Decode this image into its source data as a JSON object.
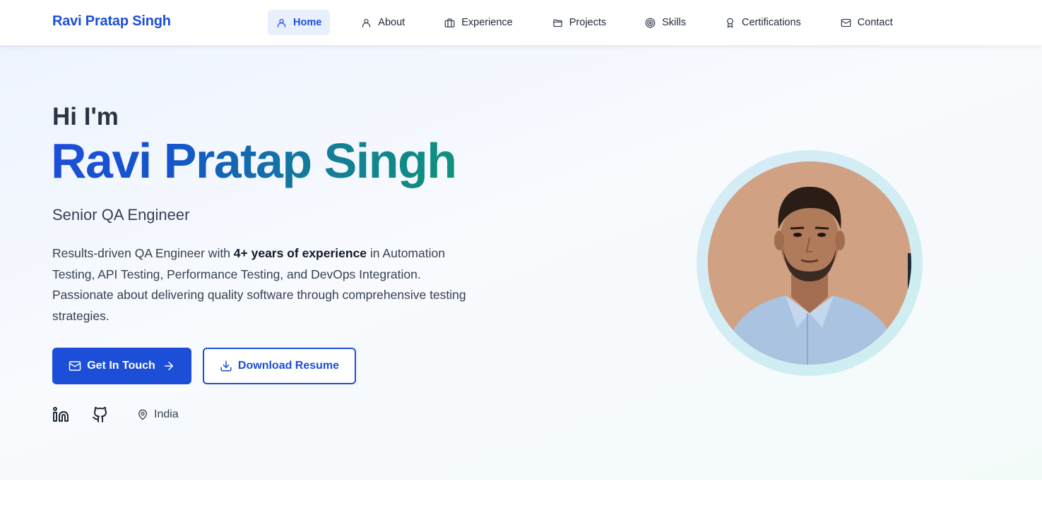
{
  "brand": "Ravi Pratap Singh",
  "nav": {
    "items": [
      {
        "label": "Home",
        "icon": "user-icon",
        "active": true
      },
      {
        "label": "About",
        "icon": "user-icon",
        "active": false
      },
      {
        "label": "Experience",
        "icon": "briefcase-icon",
        "active": false
      },
      {
        "label": "Projects",
        "icon": "folder-icon",
        "active": false
      },
      {
        "label": "Skills",
        "icon": "target-icon",
        "active": false
      },
      {
        "label": "Certifications",
        "icon": "award-icon",
        "active": false
      },
      {
        "label": "Contact",
        "icon": "mail-icon",
        "active": false
      }
    ]
  },
  "hero": {
    "greeting": "Hi I'm",
    "name": "Ravi Pratap Singh",
    "role": "Senior QA Engineer",
    "desc_part1": "Results-driven QA Engineer with ",
    "desc_bold": "4+ years of experience",
    "desc_part2": " in Automation Testing, API Testing, Performance Testing, and DevOps Integration. Passionate about delivering quality software through comprehensive testing strategies.",
    "primary_button": "Get In Touch",
    "secondary_button": "Download Resume",
    "location": "India"
  },
  "colors": {
    "brand_blue": "#1d4ed8",
    "accent_teal": "#10917c",
    "active_nav_bg": "#e8f0fd"
  }
}
